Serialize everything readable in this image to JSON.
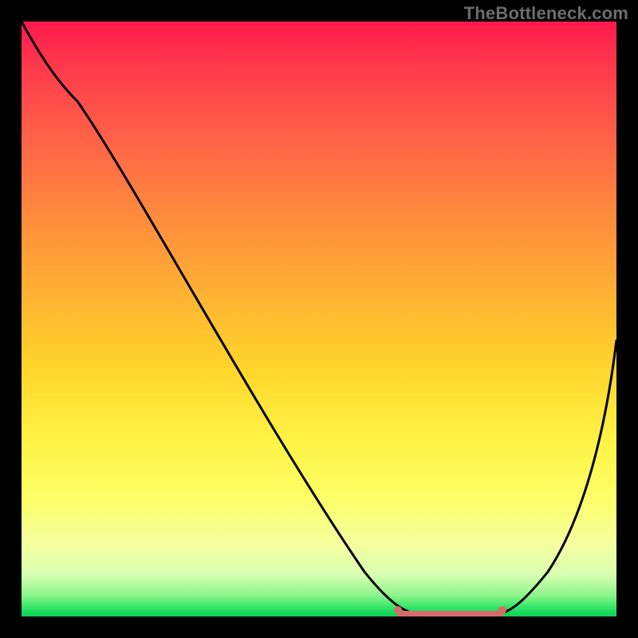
{
  "watermark": "TheBottleneck.com",
  "chart_data": {
    "type": "line",
    "title": "",
    "xlabel": "",
    "ylabel": "",
    "xlim": [
      0,
      100
    ],
    "ylim": [
      0,
      100
    ],
    "grid": false,
    "legend": false,
    "series": [
      {
        "name": "bottleneck-curve",
        "x": [
          0,
          6,
          12,
          18,
          24,
          30,
          36,
          42,
          48,
          54,
          59,
          64,
          68,
          72,
          76,
          80,
          84,
          88,
          92,
          96,
          100
        ],
        "y": [
          100,
          95,
          88,
          80,
          71,
          62,
          53,
          44,
          35,
          26,
          18,
          11,
          5,
          2,
          0,
          0,
          2,
          9,
          20,
          34,
          50
        ]
      },
      {
        "name": "flat-region",
        "x": [
          62,
          80
        ],
        "y": [
          0,
          0
        ]
      }
    ],
    "flat_region": {
      "x_start": 62,
      "x_end": 80,
      "y": 0
    },
    "colors": {
      "curve": "#000000",
      "flat_region": "#d86b6b",
      "gradient_top": "#ff1a4d",
      "gradient_bottom": "#0fd156"
    }
  }
}
